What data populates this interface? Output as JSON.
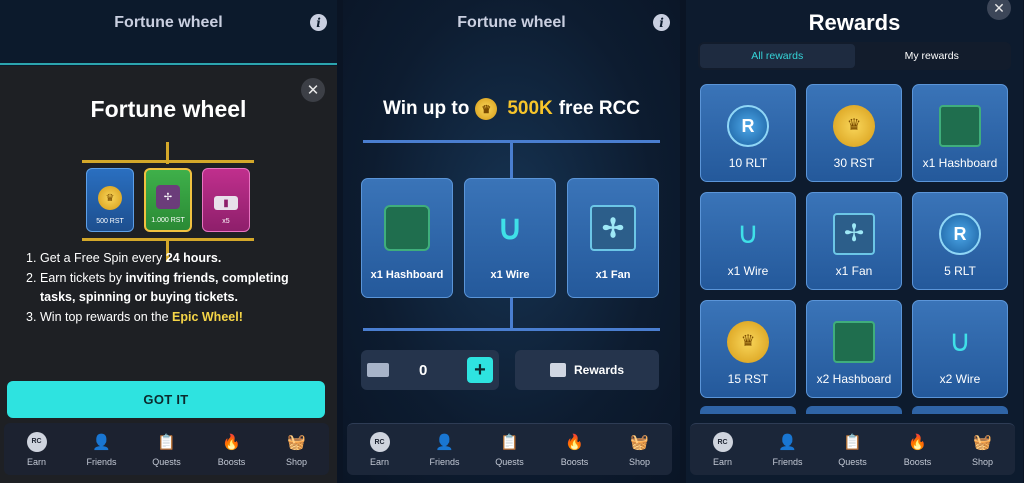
{
  "screen1": {
    "header_title": "Fortune wheel",
    "modal": {
      "title": "Fortune wheel",
      "preview_cards": [
        "500 RST",
        "1.000 RST",
        "x5"
      ],
      "rule1_num": "1.",
      "rule1_a": "Get a Free Spin every ",
      "rule1_b": "24 hours.",
      "rule2_num": "2.",
      "rule2_a": "Earn tickets by ",
      "rule2_b": "inviting friends, completing tasks, spinning or buying tickets.",
      "rule3_num": "3.",
      "rule3_a": "Win top rewards on the ",
      "rule3_b": "Epic Wheel!",
      "button": "GOT IT"
    }
  },
  "screen2": {
    "header_title": "Fortune wheel",
    "win_prefix": "Win up to",
    "win_amount": "500K",
    "win_suffix": "free RCC",
    "cards": [
      {
        "label": "x1 Hashboard"
      },
      {
        "label": "x1 Wire"
      },
      {
        "label": "x1 Fan"
      }
    ],
    "ticket_count": "0",
    "plus": "+",
    "rewards_button": "Rewards"
  },
  "screen3": {
    "title": "Rewards",
    "tabs": [
      "All rewards",
      "My rewards"
    ],
    "rewards": [
      {
        "label": "10 RLT",
        "type": "rlt"
      },
      {
        "label": "30 RST",
        "type": "rst"
      },
      {
        "label": "x1 Hashboard",
        "type": "hash"
      },
      {
        "label": "x1 Wire",
        "type": "wire"
      },
      {
        "label": "x1 Fan",
        "type": "fan"
      },
      {
        "label": "5 RLT",
        "type": "rlt"
      },
      {
        "label": "15 RST",
        "type": "rst"
      },
      {
        "label": "x2 Hashboard",
        "type": "hash"
      },
      {
        "label": "x2 Wire",
        "type": "wire"
      }
    ]
  },
  "nav": [
    "Earn",
    "Friends",
    "Quests",
    "Boosts",
    "Shop"
  ],
  "nav_rc_icon_text": "RC",
  "icons": {
    "info": "info-icon",
    "close": "close-icon",
    "ticket": "ticket-icon",
    "gift": "gift-icon",
    "crown_coin": "crown-coin-icon",
    "friends": "user-plus-icon",
    "quests": "clipboard-check-icon",
    "boosts": "flame-icon",
    "shop": "basket-icon"
  },
  "colors": {
    "accent_cyan": "#2ee3e0",
    "gold": "#f7c52b",
    "card_blue": "#2d66aa"
  }
}
